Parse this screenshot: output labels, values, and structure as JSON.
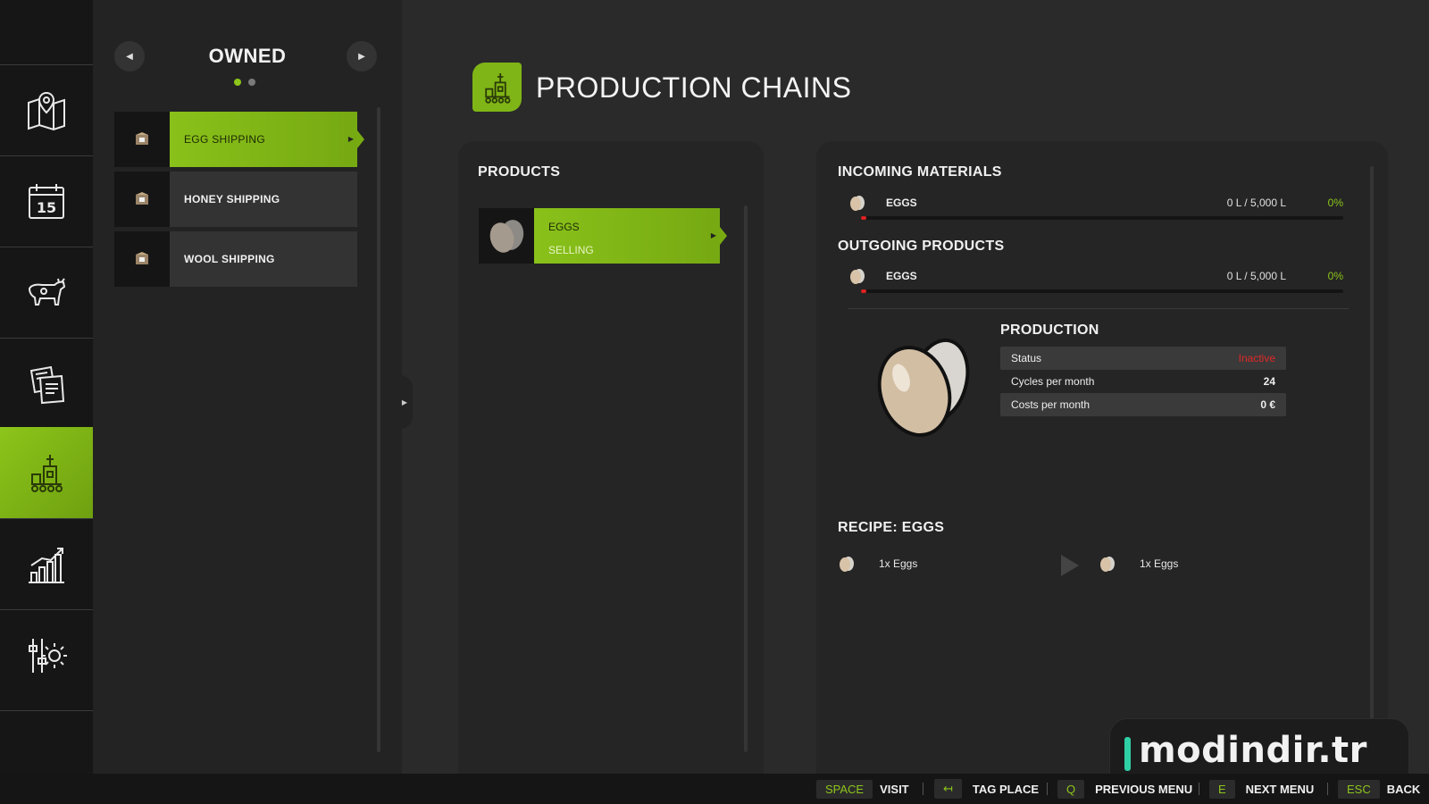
{
  "owned": {
    "title": "OWNED",
    "items": [
      {
        "label": "EGG SHIPPING"
      },
      {
        "label": "HONEY SHIPPING"
      },
      {
        "label": "WOOL SHIPPING"
      }
    ]
  },
  "header": {
    "title": "PRODUCTION CHAINS"
  },
  "products": {
    "title": "PRODUCTS",
    "items": [
      {
        "name": "EGGS",
        "status": "SELLING"
      }
    ]
  },
  "details": {
    "incoming": {
      "title": "INCOMING MATERIALS",
      "items": [
        {
          "name": "EGGS",
          "amount": "0 L / 5,000 L",
          "percent": "0%",
          "fill": 0
        }
      ]
    },
    "outgoing": {
      "title": "OUTGOING PRODUCTS",
      "items": [
        {
          "name": "EGGS",
          "amount": "0 L / 5,000 L",
          "percent": "0%",
          "fill": 0
        }
      ]
    },
    "production": {
      "title": "PRODUCTION",
      "rows": [
        {
          "label": "Status",
          "value": "Inactive"
        },
        {
          "label": "Cycles per month",
          "value": "24"
        },
        {
          "label": "Costs per month",
          "value": "0 €"
        }
      ]
    },
    "recipe": {
      "title": "RECIPE: EGGS",
      "input": "1x Eggs",
      "output": "1x Eggs"
    }
  },
  "watermark": "modindir.tr",
  "hints": [
    {
      "key": "SPACE",
      "action": "VISIT"
    },
    {
      "key": "↤",
      "action": "TAG PLACE"
    },
    {
      "key": "Q",
      "action": "PREVIOUS MENU"
    },
    {
      "key": "E",
      "action": "NEXT MENU"
    },
    {
      "key": "ESC",
      "action": "BACK"
    }
  ],
  "colors": {
    "accent": "#8cc51a",
    "inactive": "#e02828",
    "background": "#2a2a2a"
  }
}
